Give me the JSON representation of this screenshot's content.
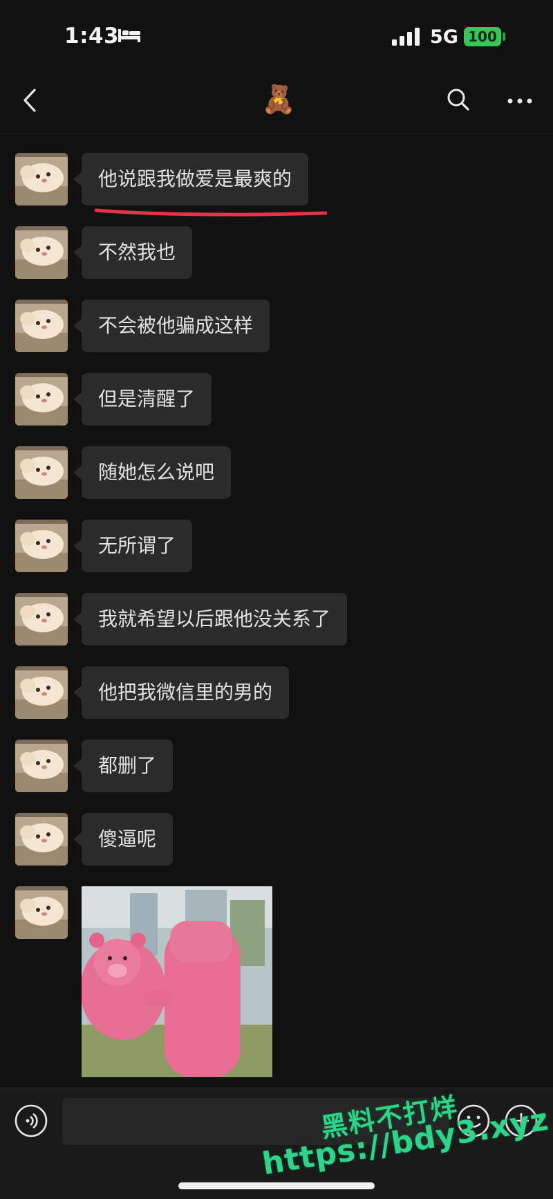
{
  "status_bar": {
    "time": "1:43",
    "network": "5G",
    "battery": "100"
  },
  "header": {
    "title_emoji": "🧸"
  },
  "messages": [
    {
      "text": "他说跟我做爱是最爽的"
    },
    {
      "text": "不然我也"
    },
    {
      "text": "不会被他骗成这样"
    },
    {
      "text": "但是清醒了"
    },
    {
      "text": "随她怎么说吧"
    },
    {
      "text": "无所谓了"
    },
    {
      "text": "我就希望以后跟他没关系了"
    },
    {
      "text": "他把我微信里的男的"
    },
    {
      "text": "都删了"
    },
    {
      "text": "傻逼呢"
    }
  ],
  "watermark": {
    "line1": "黑料不打烊",
    "line2": "https://bdy3.xyz"
  },
  "colors": {
    "bubble": "#2b2b2b",
    "background": "#111111",
    "underline": "#e8324a",
    "battery": "#35c759"
  }
}
